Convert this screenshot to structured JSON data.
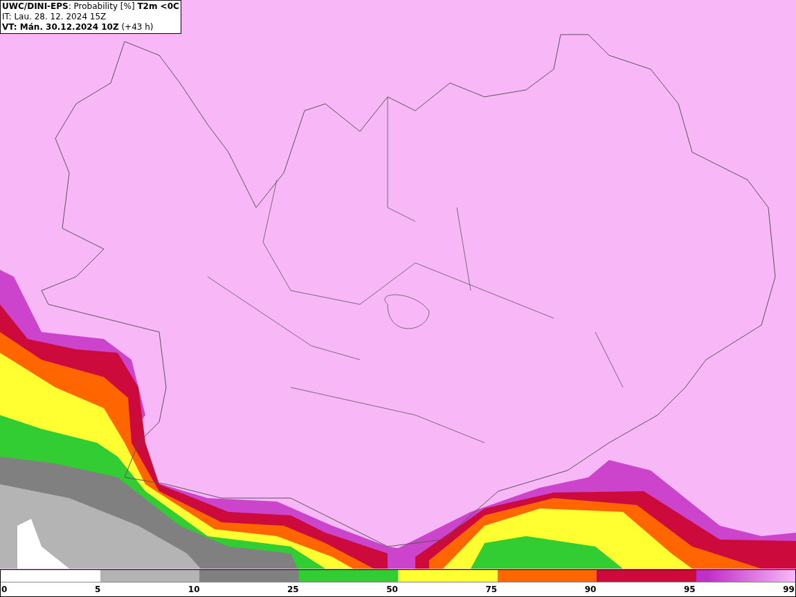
{
  "header": {
    "line_1": "**UWC/DINI-EPS**: Probability [%] **T2m <0C**",
    "line_2": "IT: Lau. 28. 12. 2024 15Z",
    "line_3": "**VT: Mán. 30.12.2024 10Z** (+43 h)"
  },
  "legend": {
    "bins": [
      {
        "color": "#ffffff"
      },
      {
        "color": "#b4b4b4"
      },
      {
        "color": "#808080"
      },
      {
        "color": "#32cd32"
      },
      {
        "color": "#ffff32"
      },
      {
        "color": "#ff6600"
      },
      {
        "color": "#cc0a3c"
      },
      {
        "color": "#c030c8",
        "kind": "gradient"
      }
    ],
    "ticks": [
      "0",
      "5",
      "10",
      "25",
      "50",
      "75",
      "90",
      "95",
      "99"
    ]
  }
}
